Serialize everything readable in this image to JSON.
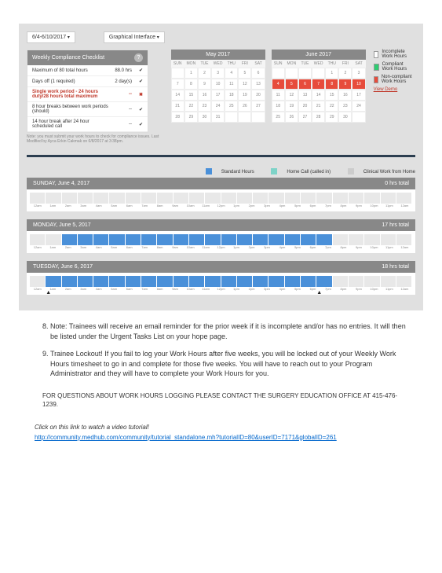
{
  "top": {
    "date_range": "6/4-6/10/2017",
    "view_mode": "Graphical Interface"
  },
  "checklist": {
    "title": "Weekly Compliance Checklist",
    "rows": [
      {
        "label": "Maximum of 80 total hours",
        "val": "88.0 hrs",
        "mark": "✔",
        "alert": false
      },
      {
        "label": "Days off (1 required)",
        "val": "2 day(s)",
        "mark": "✔",
        "alert": false
      },
      {
        "label": "Single work period - 24 hours duty/28 hours total maximum",
        "val": "--",
        "mark": "✖",
        "alert": true
      },
      {
        "label": "8 hour breaks between work periods (should)",
        "val": "--",
        "mark": "✔",
        "alert": false
      },
      {
        "label": "14 hour break after 24 hour scheduled call",
        "val": "--",
        "mark": "✔",
        "alert": false
      }
    ],
    "note": "Note: you must submit your work hours to check for compliance issues.\nLast Modified by Ayca Erkin Cakmak on 6/8/2017 at 3:38pm."
  },
  "calendars": {
    "may": {
      "title": "May 2017",
      "dow": [
        "SUN",
        "MON",
        "TUE",
        "WED",
        "THU",
        "FRI",
        "SAT"
      ],
      "weeks": [
        [
          "",
          "1",
          "2",
          "3",
          "4",
          "5",
          "6"
        ],
        [
          "7",
          "8",
          "9",
          "10",
          "11",
          "12",
          "13"
        ],
        [
          "14",
          "15",
          "16",
          "17",
          "18",
          "19",
          "20"
        ],
        [
          "21",
          "22",
          "23",
          "24",
          "25",
          "26",
          "27"
        ],
        [
          "28",
          "29",
          "30",
          "31",
          "",
          "",
          ""
        ]
      ]
    },
    "june": {
      "title": "June 2017",
      "dow": [
        "SUN",
        "MON",
        "TUE",
        "WED",
        "THU",
        "FRI",
        "SAT"
      ],
      "weeks": [
        [
          "",
          "",
          "",
          "",
          "1",
          "2",
          "3"
        ],
        [
          "4",
          "5",
          "6",
          "7",
          "8",
          "9",
          "10"
        ],
        [
          "11",
          "12",
          "13",
          "14",
          "15",
          "16",
          "17"
        ],
        [
          "18",
          "19",
          "20",
          "21",
          "22",
          "23",
          "24"
        ],
        [
          "25",
          "26",
          "27",
          "28",
          "29",
          "30",
          ""
        ]
      ],
      "red_cells": [
        "4",
        "5",
        "6",
        "7",
        "8",
        "9",
        "10"
      ]
    }
  },
  "legend": {
    "items": [
      {
        "cls": "white",
        "text": "Incomplete Work Hours"
      },
      {
        "cls": "green",
        "text": "Compliant Work Hours"
      },
      {
        "cls": "red",
        "text": "Non-compliant Work Hours"
      }
    ],
    "demo_link": "View Demo"
  },
  "shift_legend": {
    "standard": "Standard Hours",
    "home": "Home Call (called in)",
    "clinical": "Clinical Work from Home"
  },
  "days": [
    {
      "label": "SUNDAY, June 4, 2017",
      "total": "0 hrs total",
      "filled": [],
      "warns": []
    },
    {
      "label": "MONDAY, June 5, 2017",
      "total": "17 hrs total",
      "filled": [
        2,
        3,
        4,
        5,
        6,
        7,
        8,
        9,
        10,
        11,
        12,
        13,
        14,
        15,
        16,
        17,
        18
      ],
      "warns": []
    },
    {
      "label": "TUESDAY, June 6, 2017",
      "total": "18 hrs total",
      "filled": [
        1,
        2,
        3,
        4,
        5,
        6,
        7,
        8,
        9,
        10,
        11,
        12,
        13,
        14,
        15,
        16,
        17,
        18
      ],
      "warns": [
        1,
        18
      ]
    }
  ],
  "hour_labels": [
    "12am",
    "1am",
    "2am",
    "3am",
    "4am",
    "5am",
    "6am",
    "7am",
    "8am",
    "9am",
    "10am",
    "11am",
    "12pm",
    "1pm",
    "2pm",
    "3pm",
    "4pm",
    "5pm",
    "6pm",
    "7pm",
    "8pm",
    "9pm",
    "10pm",
    "11pm",
    "12am"
  ],
  "doc": {
    "note8": "Note: Trainees will receive an email reminder for the prior week if it is incomplete and/or has no entries.  It will then be listed under the Urgent Tasks List on your hope page.",
    "note9": "Trainee Lockout!  If you fail to log your Work Hours after five weeks, you will be locked out of your Weekly Work Hours timesheet to go in and complete for those five weeks.  You will have to reach out to your Program Administrator and they will have to complete your Work Hours for you.",
    "contact": "FOR QUESTIONS ABOUT WORK HOURS LOGGING PLEASE CONTACT THE SURGERY EDUCATION OFFICE AT 415-476-1239.",
    "tutorial_line": "Click on this link to watch a video tutorial!",
    "tutorial_link": "http://community.medhub.com/community/tutorial_standalone.mh?tutorialID=80&userID=7171&globalID=261"
  }
}
